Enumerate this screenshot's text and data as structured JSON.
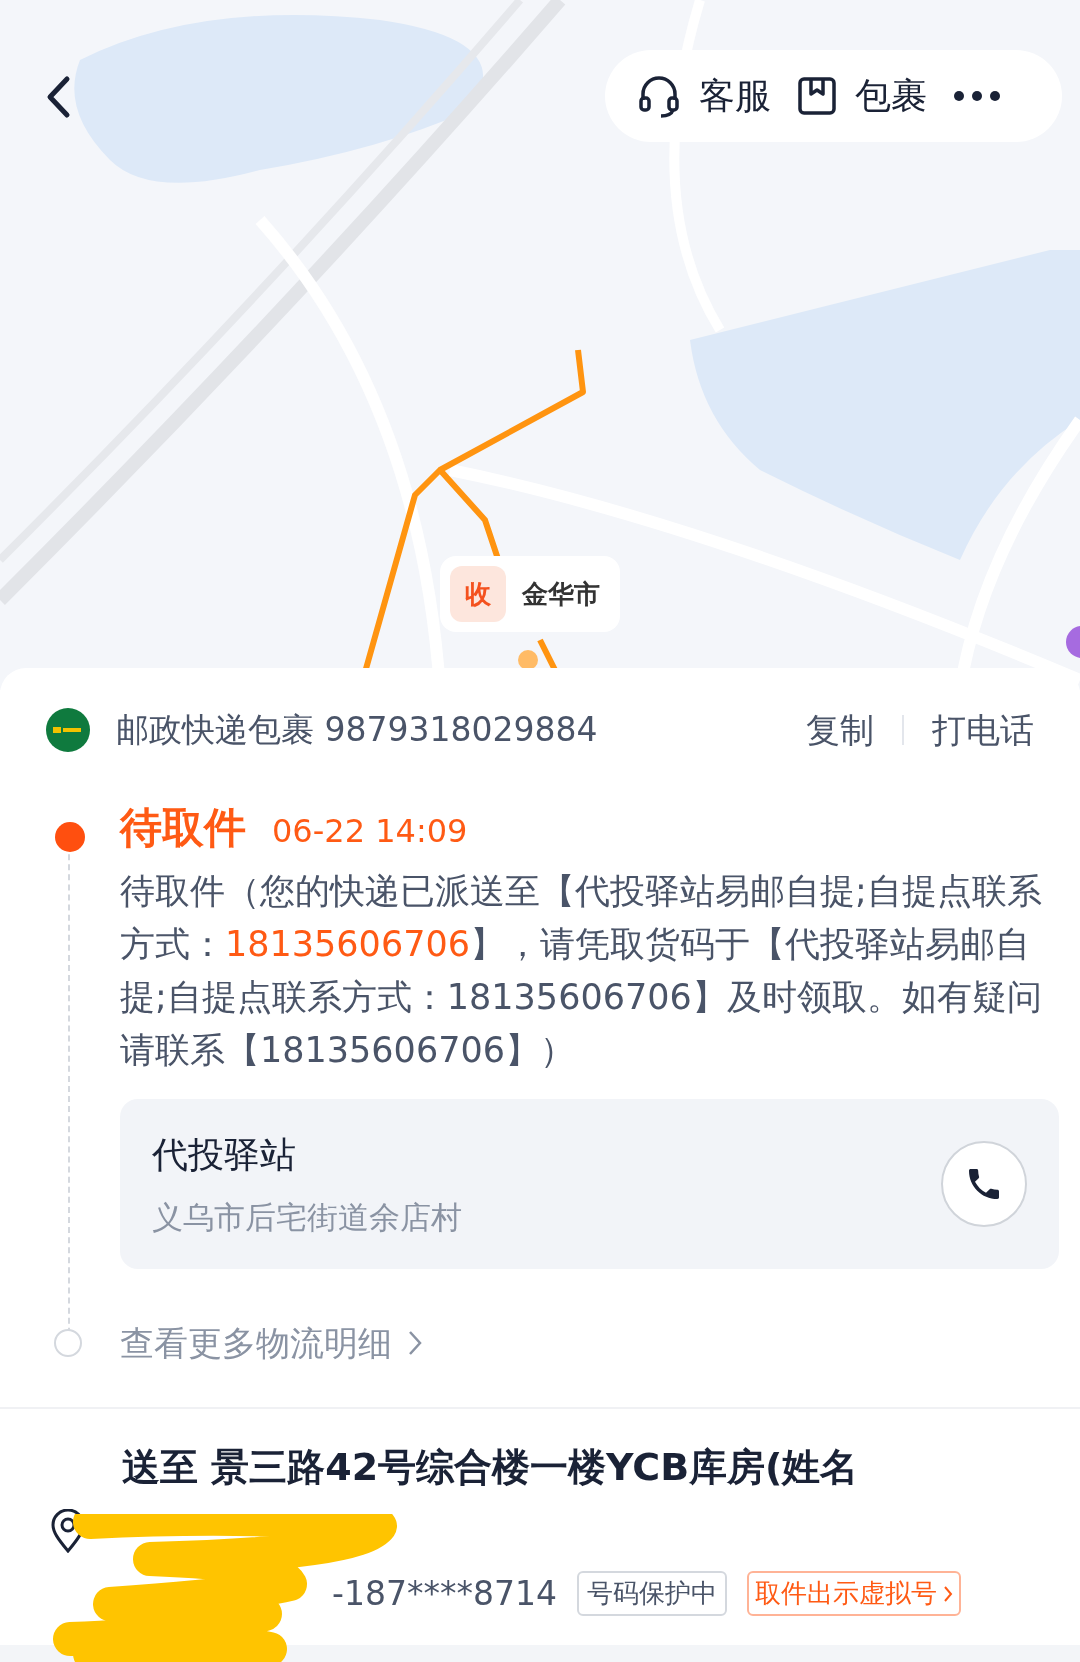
{
  "map": {
    "marker": {
      "badge": "收",
      "label": "金华市"
    }
  },
  "top_bar": {
    "actions": [
      {
        "kind": "headset",
        "label": "客服"
      },
      {
        "kind": "package",
        "label": "包裹"
      },
      {
        "kind": "more"
      }
    ]
  },
  "carrier": {
    "name": "邮政快递包裹 9879318029884",
    "actions": [
      "复制",
      "打电话"
    ]
  },
  "tracking": {
    "status": "待取件",
    "time": "06-22 14:09",
    "description": [
      {
        "text": "待取件（您的快递已派送至【代投驿站易邮自提;自提点联系方式：",
        "highlight": false
      },
      {
        "text": "18135606706",
        "highlight": true
      },
      {
        "text": "】，请凭取货码于【代投驿站易邮自提;自提点联系方式：18135606706】及时领取。如有疑问请联系【18135606706】）",
        "highlight": false
      }
    ],
    "station": {
      "name": "代投驿站",
      "address": "义乌市后宅街道余店村"
    },
    "more": "查看更多物流明细"
  },
  "delivery": {
    "address": "送至 景三路42号综合楼一楼YCB库房(姓名",
    "phone": "-187****8714",
    "tags": [
      {
        "kind": "plain",
        "text": "号码保护中"
      },
      {
        "kind": "action",
        "text": "取件出示虚拟号"
      }
    ]
  }
}
